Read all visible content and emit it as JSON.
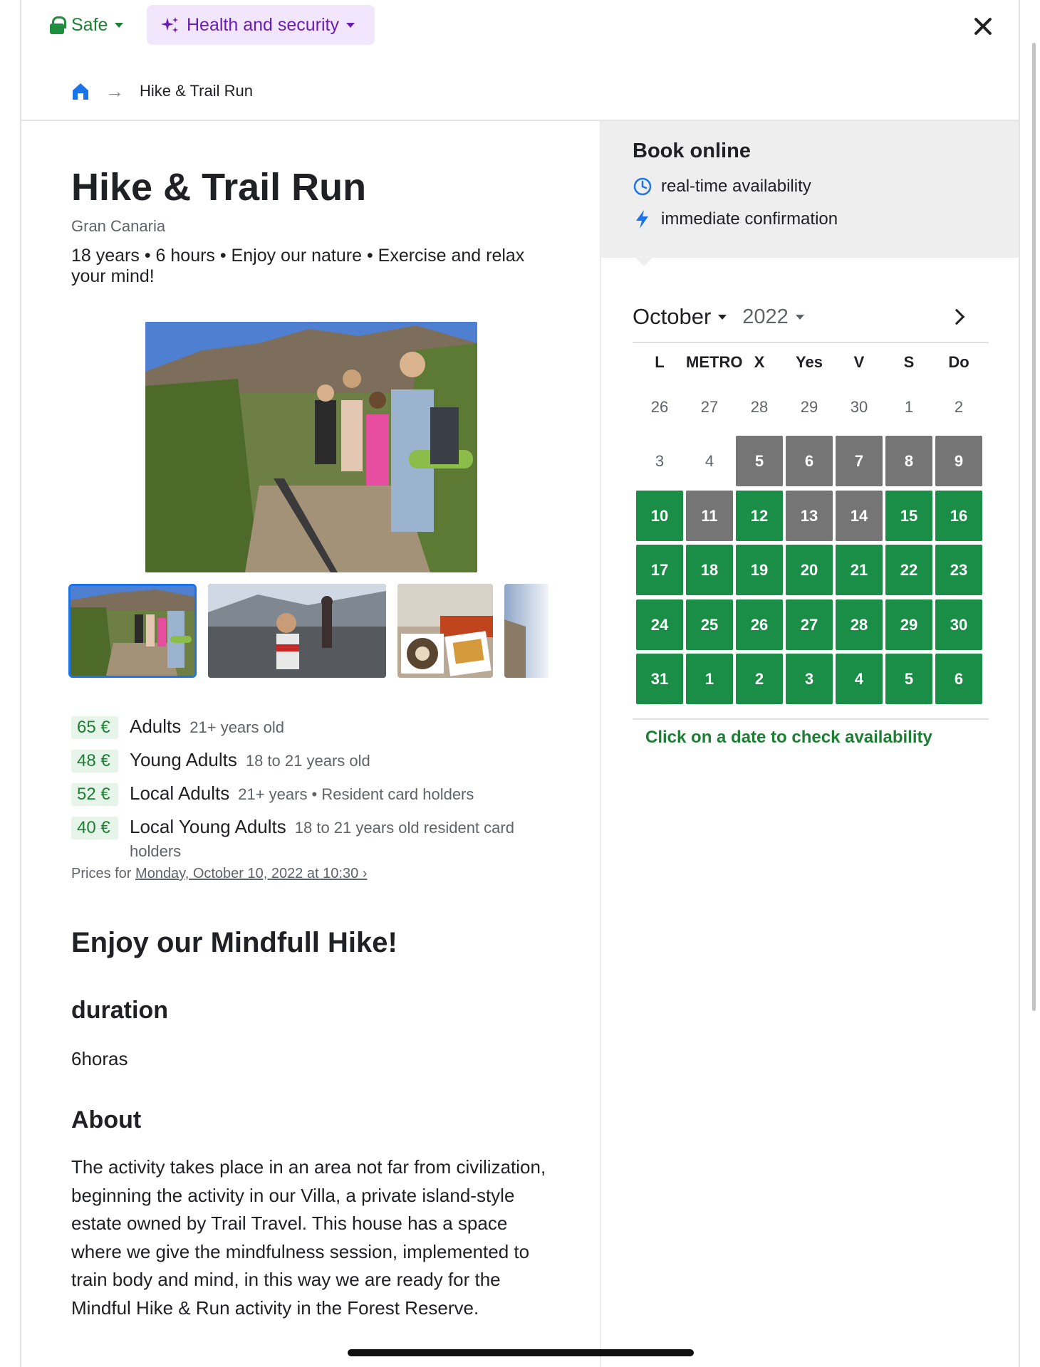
{
  "topbar": {
    "safe_label": "Safe",
    "health_label": "Health and security"
  },
  "breadcrumb": {
    "current": "Hike & Trail Run"
  },
  "activity": {
    "title": "Hike & Trail Run",
    "location": "Gran Canaria",
    "summary": "18 years • 6 hours • Enjoy our nature • Exercise and relax your mind!"
  },
  "prices": [
    {
      "amount": "65 €",
      "name": "Adults",
      "detail": "21+ years old"
    },
    {
      "amount": "48 €",
      "name": "Young Adults",
      "detail": "18 to 21 years old"
    },
    {
      "amount": "52 €",
      "name": "Local Adults",
      "detail": "21+ years • Resident card holders"
    },
    {
      "amount": "40 €",
      "name": "Local Young Adults",
      "detail": "18 to 21 years old resident card holders"
    }
  ],
  "prices_for": {
    "label": "Prices for",
    "date_link": "Monday, October 10, 2022 at 10:30 ›"
  },
  "content": {
    "heading": "Enjoy our Mindfull Hike!",
    "duration_heading": "duration",
    "duration_value": "6horas",
    "about_heading": "About",
    "about_text": "The activity takes place in an area not far from civilization, beginning the activity in our Villa, a private island-style estate owned by Trail Travel. This house has a space where we give the mindfulness session, implemented to train body and mind, in this way we are ready for the Mindful Hike & Run activity in the Forest Reserve."
  },
  "booking": {
    "title": "Book online",
    "feature_1": "real-time availability",
    "feature_2": "immediate confirmation"
  },
  "calendar": {
    "month": "October",
    "year": "2022",
    "weekdays": [
      "L",
      "METRO",
      "X",
      "Yes",
      "V",
      "S",
      "Do"
    ],
    "rows": [
      [
        {
          "d": "26",
          "s": "other"
        },
        {
          "d": "27",
          "s": "other"
        },
        {
          "d": "28",
          "s": "other"
        },
        {
          "d": "29",
          "s": "other"
        },
        {
          "d": "30",
          "s": "other"
        },
        {
          "d": "1",
          "s": "plain"
        },
        {
          "d": "2",
          "s": "plain"
        }
      ],
      [
        {
          "d": "3",
          "s": "plain"
        },
        {
          "d": "4",
          "s": "plain"
        },
        {
          "d": "5",
          "s": "grey"
        },
        {
          "d": "6",
          "s": "grey"
        },
        {
          "d": "7",
          "s": "grey"
        },
        {
          "d": "8",
          "s": "grey"
        },
        {
          "d": "9",
          "s": "grey"
        }
      ],
      [
        {
          "d": "10",
          "s": "green"
        },
        {
          "d": "11",
          "s": "grey"
        },
        {
          "d": "12",
          "s": "green"
        },
        {
          "d": "13",
          "s": "grey"
        },
        {
          "d": "14",
          "s": "grey"
        },
        {
          "d": "15",
          "s": "green"
        },
        {
          "d": "16",
          "s": "green"
        }
      ],
      [
        {
          "d": "17",
          "s": "green"
        },
        {
          "d": "18",
          "s": "green"
        },
        {
          "d": "19",
          "s": "green"
        },
        {
          "d": "20",
          "s": "green"
        },
        {
          "d": "21",
          "s": "green"
        },
        {
          "d": "22",
          "s": "green"
        },
        {
          "d": "23",
          "s": "green"
        }
      ],
      [
        {
          "d": "24",
          "s": "green"
        },
        {
          "d": "25",
          "s": "green"
        },
        {
          "d": "26",
          "s": "green"
        },
        {
          "d": "27",
          "s": "green"
        },
        {
          "d": "28",
          "s": "green"
        },
        {
          "d": "29",
          "s": "green"
        },
        {
          "d": "30",
          "s": "green"
        }
      ],
      [
        {
          "d": "31",
          "s": "green"
        },
        {
          "d": "1",
          "s": "green"
        },
        {
          "d": "2",
          "s": "green"
        },
        {
          "d": "3",
          "s": "green"
        },
        {
          "d": "4",
          "s": "green"
        },
        {
          "d": "5",
          "s": "green"
        },
        {
          "d": "6",
          "s": "green"
        }
      ]
    ],
    "hint": "Click on a date to check availability"
  },
  "colors": {
    "accent_green": "#1a8d46",
    "unavailable_grey": "#757575",
    "health_purple": "#6a1fb4",
    "link_blue": "#1a73e8"
  },
  "icons": [
    "lock-icon",
    "sparkle-icon",
    "home-icon",
    "arrow-right-icon",
    "close-icon",
    "clock-icon",
    "lightning-icon",
    "chevron-right-icon"
  ]
}
